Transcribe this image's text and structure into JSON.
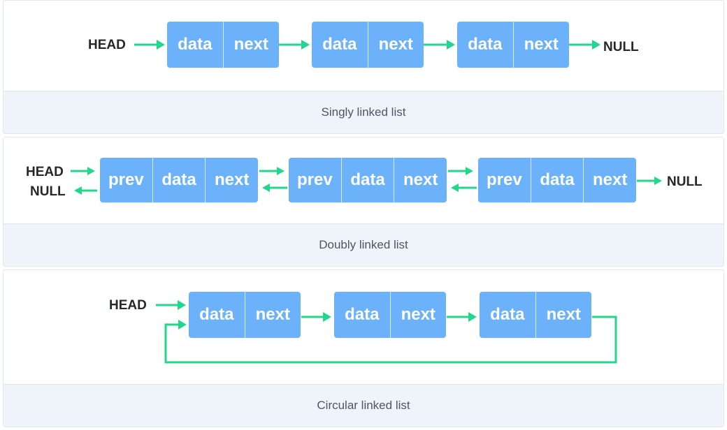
{
  "colors": {
    "node_fill": "#6bb2fb",
    "arrow": "#22d78a",
    "caption_bg": "#eff3fa",
    "label_text": "#25272b"
  },
  "singly": {
    "head_label": "HEAD",
    "null_label": "NULL",
    "caption": "Singly linked list",
    "nodes": [
      {
        "data": "data",
        "next": "next"
      },
      {
        "data": "data",
        "next": "next"
      },
      {
        "data": "data",
        "next": "next"
      }
    ]
  },
  "doubly": {
    "head_label": "HEAD",
    "null_left_label": "NULL",
    "null_right_label": "NULL",
    "caption": "Doubly linked list",
    "nodes": [
      {
        "prev": "prev",
        "data": "data",
        "next": "next"
      },
      {
        "prev": "prev",
        "data": "data",
        "next": "next"
      },
      {
        "prev": "prev",
        "data": "data",
        "next": "next"
      }
    ]
  },
  "circular": {
    "head_label": "HEAD",
    "caption": "Circular linked list",
    "nodes": [
      {
        "data": "data",
        "next": "next"
      },
      {
        "data": "data",
        "next": "next"
      },
      {
        "data": "data",
        "next": "next"
      }
    ]
  }
}
